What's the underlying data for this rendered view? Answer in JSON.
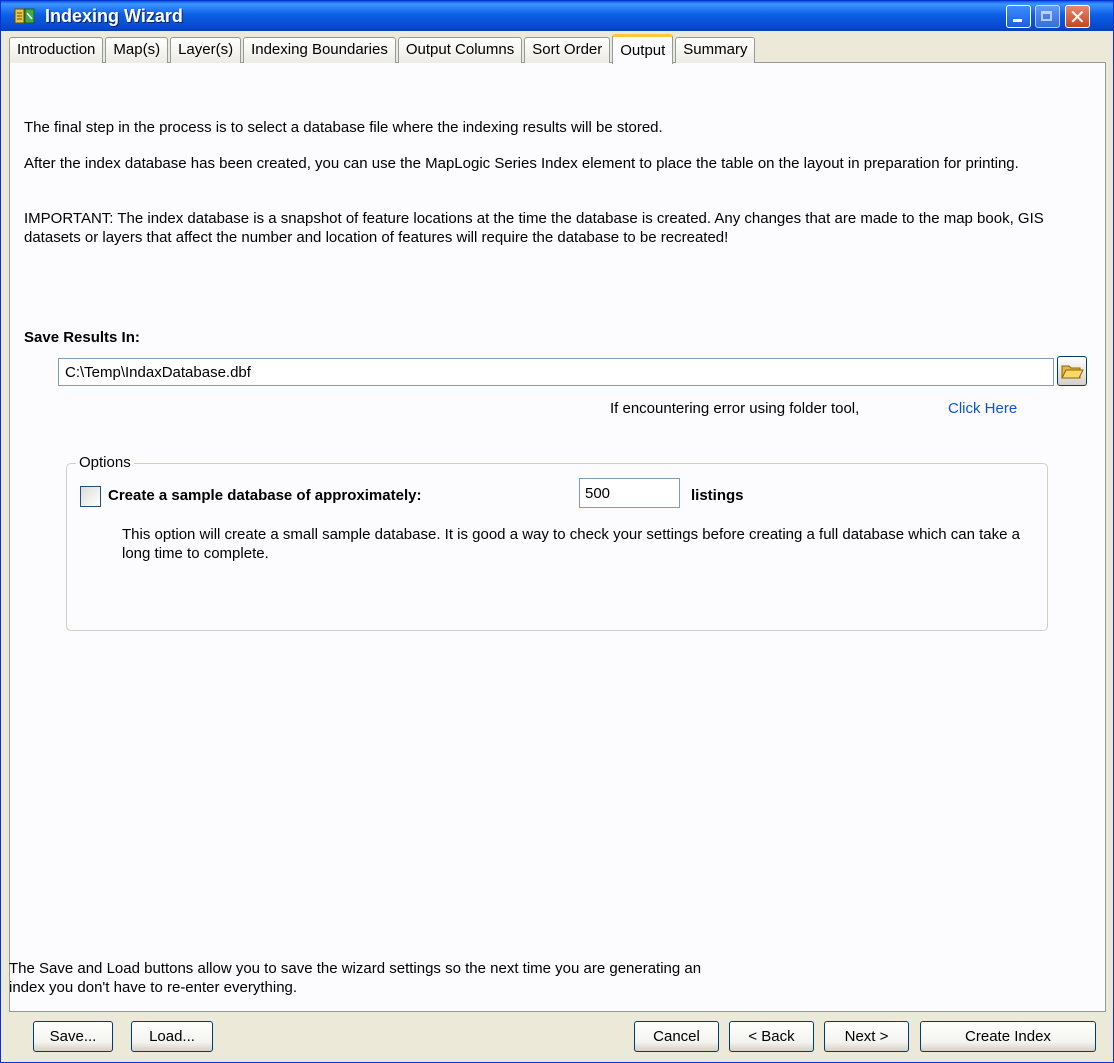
{
  "window": {
    "title": "Indexing Wizard"
  },
  "tabs": [
    "Introduction",
    "Map(s)",
    "Layer(s)",
    "Indexing Boundaries",
    "Output Columns",
    "Sort Order",
    "Output",
    "Summary"
  ],
  "active_tab": "Output",
  "intro": {
    "p1": "The final step in the process is to select a database file where the indexing results will be stored.",
    "p2": "After the index database has been created, you can use the MapLogic Series Index element to place the table on the layout in preparation for printing.",
    "p3": "IMPORTANT:  The index database is a snapshot of feature locations at the time the database is created.  Any changes that are made to the map book, GIS datasets or layers that affect the number and location of features will require the database to be recreated!"
  },
  "save": {
    "label": "Save Results In:",
    "path_value": "C:\\Temp\\IndaxDatabase.dbf",
    "error_note": "If encountering error using folder tool,",
    "click_here": "Click Here"
  },
  "options": {
    "legend": "Options",
    "checkbox_checked": false,
    "sample_label": "Create a sample database of approximately:",
    "sample_value": "500",
    "listings_label": "listings",
    "note": "This option will create a small sample database.  It is good a way to check your settings before creating a full database which can take a long time to complete."
  },
  "footer_note": "The Save and Load buttons allow you to save the wizard settings so the next time you are generating an index you don't have to re-enter everything.",
  "buttons": {
    "save": "Save...",
    "load": "Load...",
    "cancel": "Cancel",
    "back": "< Back",
    "next": "Next >",
    "create": "Create Index"
  },
  "colors": {
    "titlebar": "#0c60e6",
    "link": "#0e54c7",
    "active_tab_accent": "#ffc83c"
  }
}
